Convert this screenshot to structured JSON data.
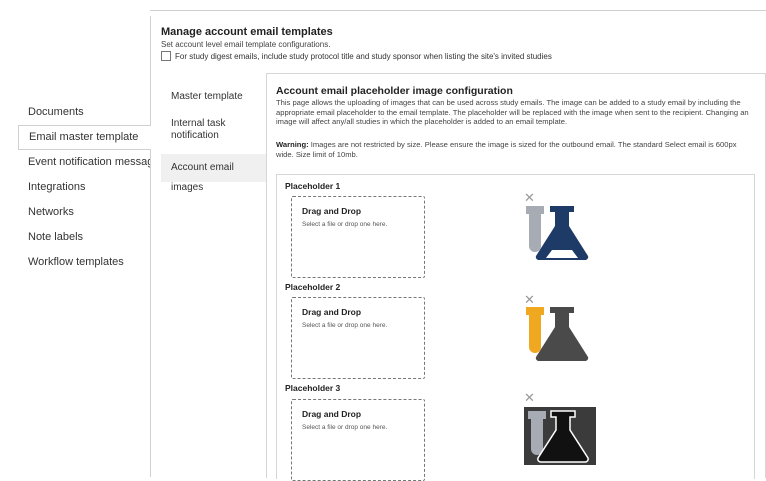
{
  "header": {
    "title": "Manage account email templates",
    "subtitle": "Set account level email template configurations.",
    "digest_option": "For study digest emails, include study protocol title and study sponsor when listing the site's invited studies"
  },
  "left_nav": {
    "items": [
      {
        "label": "Documents"
      },
      {
        "label": "Email master template"
      },
      {
        "label": "Event notification messages"
      },
      {
        "label": "Integrations"
      },
      {
        "label": "Networks"
      },
      {
        "label": "Note labels"
      },
      {
        "label": "Workflow templates"
      }
    ],
    "active": "Email master template"
  },
  "inner_nav": {
    "items": [
      {
        "label": "Master template"
      },
      {
        "label": "Internal task notification"
      },
      {
        "label": "Account email images"
      }
    ],
    "active": "Account email images"
  },
  "content": {
    "title": "Account email placeholder image configuration",
    "description": "This page allows the uploading of images that can be used across study emails. The image can be added to a study email by including the appropriate email placeholder to the email template. The placeholder will be replaced with the image when sent to the recipient. Changing an image will affect any/all studies in which the placeholder is added to an email template.",
    "warning_label": "Warning:",
    "warning_text": " Images are not restricted by size. Please ensure the image is sized for the outbound email. The standard Select email is 600px wide. Size limit of 10mb."
  },
  "placeholders": [
    {
      "label": "Placeholder 1",
      "drop_title": "Drag and Drop",
      "drop_hint": "Select a file or drop one here.",
      "tube_color": "#a7abb3",
      "flask_color": "#1e3a66",
      "bg": "none"
    },
    {
      "label": "Placeholder 2",
      "drop_title": "Drag and Drop",
      "drop_hint": "Select a file or drop one here.",
      "tube_color": "#f0a820",
      "flask_color": "#4a4a4a",
      "bg": "none"
    },
    {
      "label": "Placeholder 3",
      "drop_title": "Drag and Drop",
      "drop_hint": "Select a file or drop one here.",
      "tube_color": "#a7abb3",
      "flask_color": "#111111",
      "bg": "#3b3b3b"
    }
  ],
  "icons": {
    "remove": "close-icon",
    "image": "lab-flask-tube-image"
  }
}
